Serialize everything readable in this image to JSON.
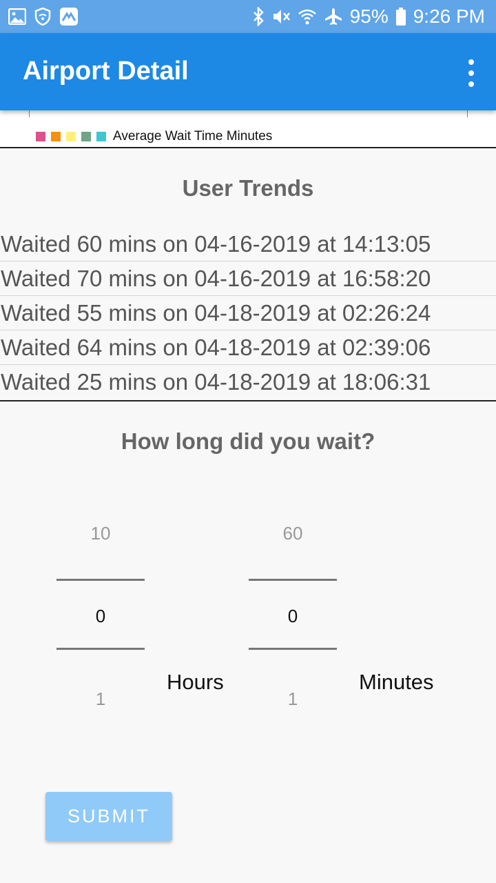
{
  "status_bar": {
    "battery": "95%",
    "time": "9:26 PM",
    "icons": [
      "gallery-icon",
      "wifi-shield-icon",
      "app-icon",
      "bluetooth-icon",
      "mute-vibrate-icon",
      "wifi-icon",
      "airplane-icon",
      "battery-icon"
    ]
  },
  "app_bar": {
    "title": "Airport Detail",
    "menu_icon": "more-vertical-icon"
  },
  "chart_data": {
    "type": "bar",
    "legend": [
      "Average Wait Time Minutes"
    ],
    "legend_colors": [
      "#e0508a",
      "#f7910f",
      "#fef17a",
      "#6da585",
      "#3cc7d2"
    ]
  },
  "user_trends": {
    "title": "User Trends",
    "entries": [
      "Waited 60 mins on 04-16-2019 at 14:13:05",
      "Waited 70 mins on 04-16-2019 at 16:58:20",
      "Waited 55 mins on 04-18-2019 at 02:26:24",
      "Waited 64 mins on 04-18-2019 at 02:39:06",
      "Waited 25 mins on 04-18-2019 at 18:06:31"
    ]
  },
  "wait_form": {
    "title": "How long did you wait?",
    "hours": {
      "prev": "10",
      "selected": "0",
      "next": "1",
      "label": "Hours"
    },
    "minutes": {
      "prev": "60",
      "selected": "0",
      "next": "1",
      "label": "Minutes"
    },
    "submit_label": "SUBMIT"
  },
  "colors": {
    "status_bar": "#5fa5e8",
    "app_bar": "#1e88e5",
    "submit_disabled": "#90caf9"
  }
}
